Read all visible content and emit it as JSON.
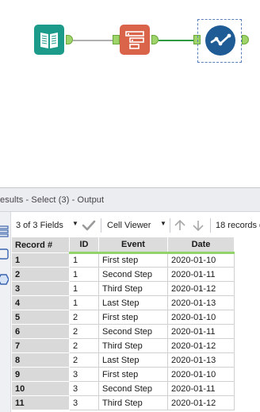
{
  "canvas": {
    "tools": [
      {
        "name": "Input Data",
        "icon": "book-icon",
        "color": "#1c9a8a"
      },
      {
        "name": "Select",
        "icon": "select-columns-icon",
        "color": "#d9644a"
      },
      {
        "name": "Output",
        "icon": "output-check-icon",
        "color": "#1f5c95"
      }
    ],
    "connection_colors": [
      "#b0b0b0",
      "#2f9a44"
    ],
    "anchor_color": "#9fd46a"
  },
  "results": {
    "title": "esults - Select (3) - Output",
    "sidebar_icons": [
      "stack-icon",
      "square-icon",
      "hexagon-icon"
    ]
  },
  "toolbar": {
    "fields_label": "3 of 3 Fields",
    "viewer_label": "Cell Viewer",
    "records_label": "18 records d"
  },
  "grid": {
    "headers": [
      "Record #",
      "ID",
      "Event",
      "Date"
    ],
    "accent_color": "#92d36b",
    "rows": [
      [
        "1",
        "1",
        "First step",
        "2020-01-10"
      ],
      [
        "2",
        "1",
        "Second Step",
        "2020-01-11"
      ],
      [
        "3",
        "1",
        "Third Step",
        "2020-01-12"
      ],
      [
        "4",
        "1",
        "Last Step",
        "2020-01-13"
      ],
      [
        "5",
        "2",
        "First step",
        "2020-01-10"
      ],
      [
        "6",
        "2",
        "Second Step",
        "2020-01-11"
      ],
      [
        "7",
        "2",
        "Third Step",
        "2020-01-12"
      ],
      [
        "8",
        "2",
        "Last Step",
        "2020-01-13"
      ],
      [
        "9",
        "3",
        "First step",
        "2020-01-10"
      ],
      [
        "10",
        "3",
        "Second Step",
        "2020-01-11"
      ],
      [
        "11",
        "3",
        "Third Step",
        "2020-01-12"
      ]
    ]
  }
}
